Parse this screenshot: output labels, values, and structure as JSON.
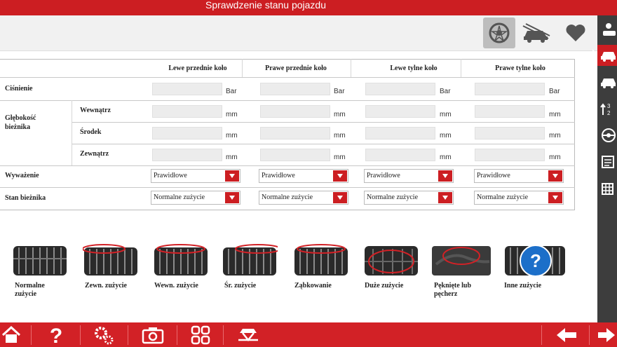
{
  "window": {
    "title": "Sprawdzenie stanu pojazdu"
  },
  "toolbar": {
    "buttons": [
      {
        "icon": "wheel-icon",
        "active": true
      },
      {
        "icon": "car-damage-icon",
        "active": false
      },
      {
        "icon": "heart-icon",
        "active": false
      }
    ]
  },
  "sidebar": {
    "items": [
      {
        "icon": "person-car-icon"
      },
      {
        "icon": "car-front-icon",
        "active": true
      },
      {
        "icon": "car-side-icon"
      },
      {
        "icon": "tire-pressure-icon"
      },
      {
        "icon": "steering-icon"
      },
      {
        "icon": "document-icon"
      },
      {
        "icon": "grid-icon"
      }
    ]
  },
  "table": {
    "columns": [
      "Lewe przednie koło",
      "Prawe przednie koło",
      "Lewe tylne koło",
      "Prawe tylne koło"
    ],
    "rows": {
      "pressure": "Ciśnienie",
      "tread_depth": "Głębokość bieżnika",
      "inner": "Wewnątrz",
      "middle": "Środek",
      "outer": "Zewnątrz",
      "balance": "Wyważenie",
      "tread_state": "Stan bieżnika"
    },
    "units": {
      "pressure": "Bar",
      "depth": "mm"
    },
    "pressure_values": [
      "",
      "",
      "",
      ""
    ],
    "inner_values": [
      "",
      "",
      "",
      ""
    ],
    "middle_values": [
      "",
      "",
      "",
      ""
    ],
    "outer_values": [
      "",
      "",
      "",
      ""
    ],
    "balance_values": [
      "Prawidłowe",
      "Prawidłowe",
      "Prawidłowe",
      "Prawidłowe"
    ],
    "tread_state_values": [
      "Normalne zużycie",
      "Normalne zużycie",
      "Normalne zużycie",
      "Normalne zużycie"
    ]
  },
  "wear_types": [
    {
      "label": "Normalne zużycie"
    },
    {
      "label": "Zewn. zużycie"
    },
    {
      "label": "Wewn. zużycie"
    },
    {
      "label": "Śr. zużycie"
    },
    {
      "label": "Ząbkowanie"
    },
    {
      "label": "Duże zużycie"
    },
    {
      "label": "Pęknięte lub pęcherz"
    },
    {
      "label": "Inne zużycie"
    }
  ],
  "bottom_bar": {
    "buttons": [
      "home-icon",
      "help-icon",
      "settings-icon",
      "camera-icon",
      "apps-icon",
      "lift-icon",
      "back-arrow-icon",
      "forward-arrow-icon"
    ]
  },
  "colors": {
    "accent": "#cc1e22",
    "sidebar": "#3d3d3d"
  }
}
